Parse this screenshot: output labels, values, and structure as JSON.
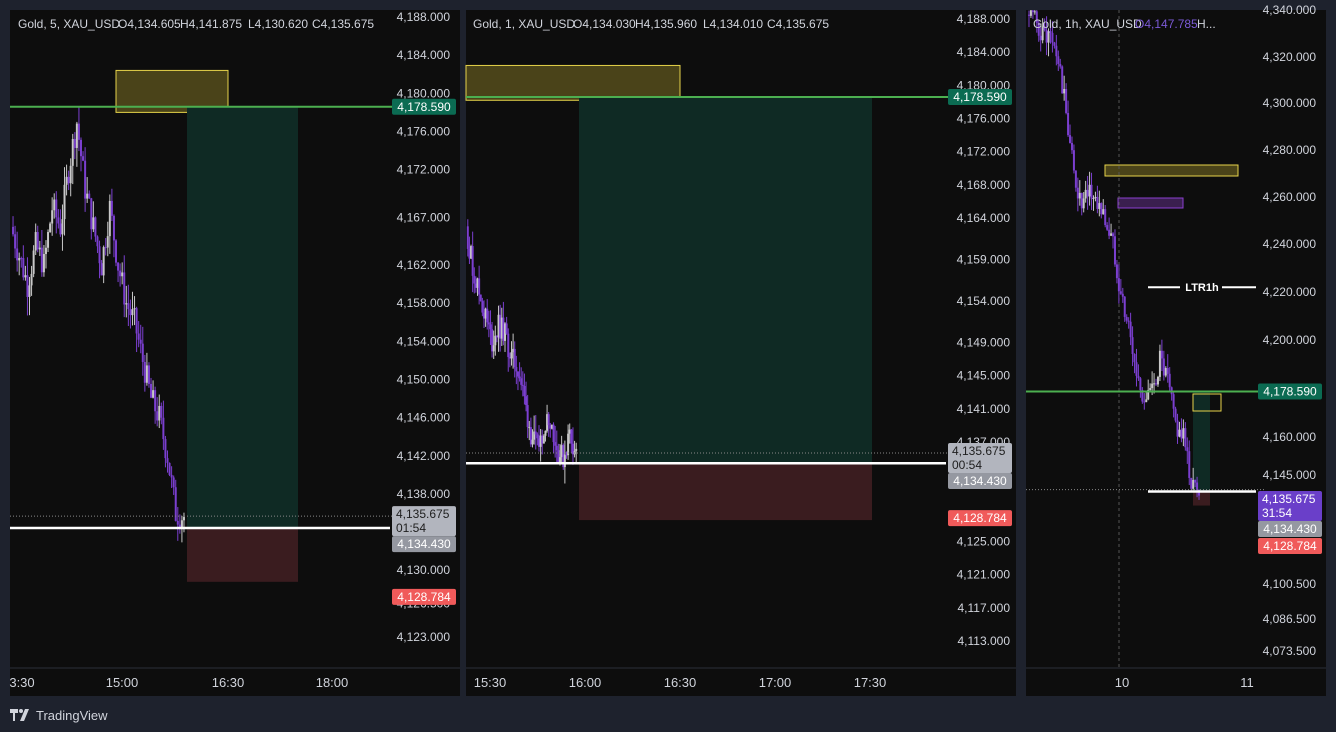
{
  "brand": {
    "name": "TradingView",
    "logo_icon": "tradingview-logo-icon"
  },
  "colors": {
    "background": "#0d0d0d",
    "frame": "#1e222d",
    "text": "#d1d4dc",
    "bull_candle": "#c8c8c8",
    "bear_candle": "#7b3fd0",
    "green_line": "#4caf50",
    "green_label": "#0b6b52",
    "white_line": "#ffffff",
    "price_label": "#b2b5be",
    "stop_label": "#f05a5a",
    "current_label_purple": "#6a3fc9",
    "profit_zone": "#0f2a24",
    "loss_zone": "#3a1c1f",
    "supply_zone": "#4a4319",
    "zone_border": "#e6d34a",
    "purple_zone": "#3a1f4f",
    "purple_border": "#8a3fd0"
  },
  "chart_data": [
    {
      "type": "candlestick",
      "symbol": "Gold, 5, XAU_USD",
      "ohlc_header": {
        "open": "O4,134.605",
        "high": "H4,141.875",
        "low": "L4,130.620",
        "close": "C4,135.675"
      },
      "y_ticks": [
        "4,188.000",
        "4,184.000",
        "4,180.000",
        "4,176.000",
        "4,172.000",
        "4,167.000",
        "4,162.000",
        "4,158.000",
        "4,154.000",
        "4,150.000",
        "4,146.000",
        "4,142.000",
        "4,138.000",
        "4,130.000",
        "4,126.500",
        "4,123.000"
      ],
      "ylim": [
        4120.8,
        4188.9
      ],
      "x_ticks": [
        "3:30",
        "15:00",
        "16:30",
        "18:00"
      ],
      "price_labels": [
        {
          "text": "4,178.590",
          "role": "target-line"
        },
        {
          "text": "4,135.675",
          "role": "current-price"
        },
        {
          "text": "01:54",
          "role": "countdown"
        },
        {
          "text": "4,134.430",
          "role": "entry-line"
        },
        {
          "text": "4,128.784",
          "role": "stop-loss"
        }
      ],
      "levels": {
        "target": 4178.59,
        "current": 4135.675,
        "entry": 4134.43,
        "stop": 4128.784
      },
      "supply_zone": {
        "from": 4178.0,
        "to": 4182.4
      },
      "trend": [
        4166,
        4163,
        4160,
        4164,
        4162,
        4168,
        4166,
        4172,
        4177,
        4170,
        4166,
        4162,
        4168,
        4162,
        4158,
        4156,
        4152,
        4148,
        4146,
        4142,
        4136,
        4135.6
      ]
    },
    {
      "type": "candlestick",
      "symbol": "Gold, 1, XAU_USD",
      "ohlc_header": {
        "open": "O4,134.030",
        "high": "H4,135.960",
        "low": "L4,134.010",
        "close": "C4,135.675"
      },
      "y_ticks": [
        "4,188.000",
        "4,184.000",
        "4,180.000",
        "4,176.000",
        "4,172.000",
        "4,168.000",
        "4,164.000",
        "4,159.000",
        "4,154.000",
        "4,149.000",
        "4,145.000",
        "4,141.000",
        "4,137.000",
        "4,125.000",
        "4,121.000",
        "4,117.000",
        "4,113.000"
      ],
      "ylim": [
        4110.5,
        4189.2
      ],
      "x_ticks": [
        "15:30",
        "16:00",
        "16:30",
        "17:00",
        "17:30"
      ],
      "price_labels": [
        {
          "text": "4,178.590",
          "role": "target-line"
        },
        {
          "text": "4,135.675",
          "role": "current-price"
        },
        {
          "text": "00:54",
          "role": "countdown"
        },
        {
          "text": "4,134.430",
          "role": "entry-line"
        },
        {
          "text": "4,128.784",
          "role": "stop-loss"
        }
      ],
      "levels": {
        "target": 4178.59,
        "current": 4135.675,
        "entry": 4134.43,
        "stop": 4128.784
      },
      "supply_zone": {
        "from": 4178.2,
        "to": 4182.4
      },
      "trend": [
        4163,
        4158,
        4155,
        4152,
        4149,
        4151,
        4150,
        4147,
        4146,
        4142,
        4138,
        4136,
        4139,
        4140,
        4136,
        4135,
        4138,
        4135.6
      ]
    },
    {
      "type": "candlestick",
      "symbol": "Gold, 1h, XAU_USD",
      "ohlc_header": {
        "open": "O4,147.785",
        "high": "H...",
        "low": "",
        "close": ""
      },
      "y_ticks": [
        "4,340.000",
        "4,320.000",
        "4,300.000",
        "4,280.000",
        "4,260.000",
        "4,240.000",
        "4,220.000",
        "4,200.000",
        "4,180.000",
        "4,160.000",
        "4,145.000",
        "4,115.000",
        "4,100.500",
        "4,086.500",
        "4,073.500"
      ],
      "x_ticks": [
        "10",
        "11"
      ],
      "annotation": "LTR1h",
      "price_labels": [
        {
          "text": "4,178.590",
          "role": "target-line"
        },
        {
          "text": "4,135.675",
          "role": "current-price"
        },
        {
          "text": "31:54",
          "role": "countdown"
        },
        {
          "text": "4,134.430",
          "role": "entry-line"
        },
        {
          "text": "4,128.784",
          "role": "stop-loss"
        }
      ],
      "levels": {
        "target": 4178.59,
        "current": 4135.675,
        "entry": 4134.43,
        "stop": 4128.784,
        "ltr": 4222
      },
      "trend": [
        4338,
        4335,
        4330,
        4328,
        4318,
        4296,
        4270,
        4255,
        4262,
        4258,
        4250,
        4240,
        4220,
        4205,
        4185,
        4176,
        4178,
        4192,
        4182,
        4165,
        4160,
        4140,
        4135.6
      ]
    }
  ]
}
